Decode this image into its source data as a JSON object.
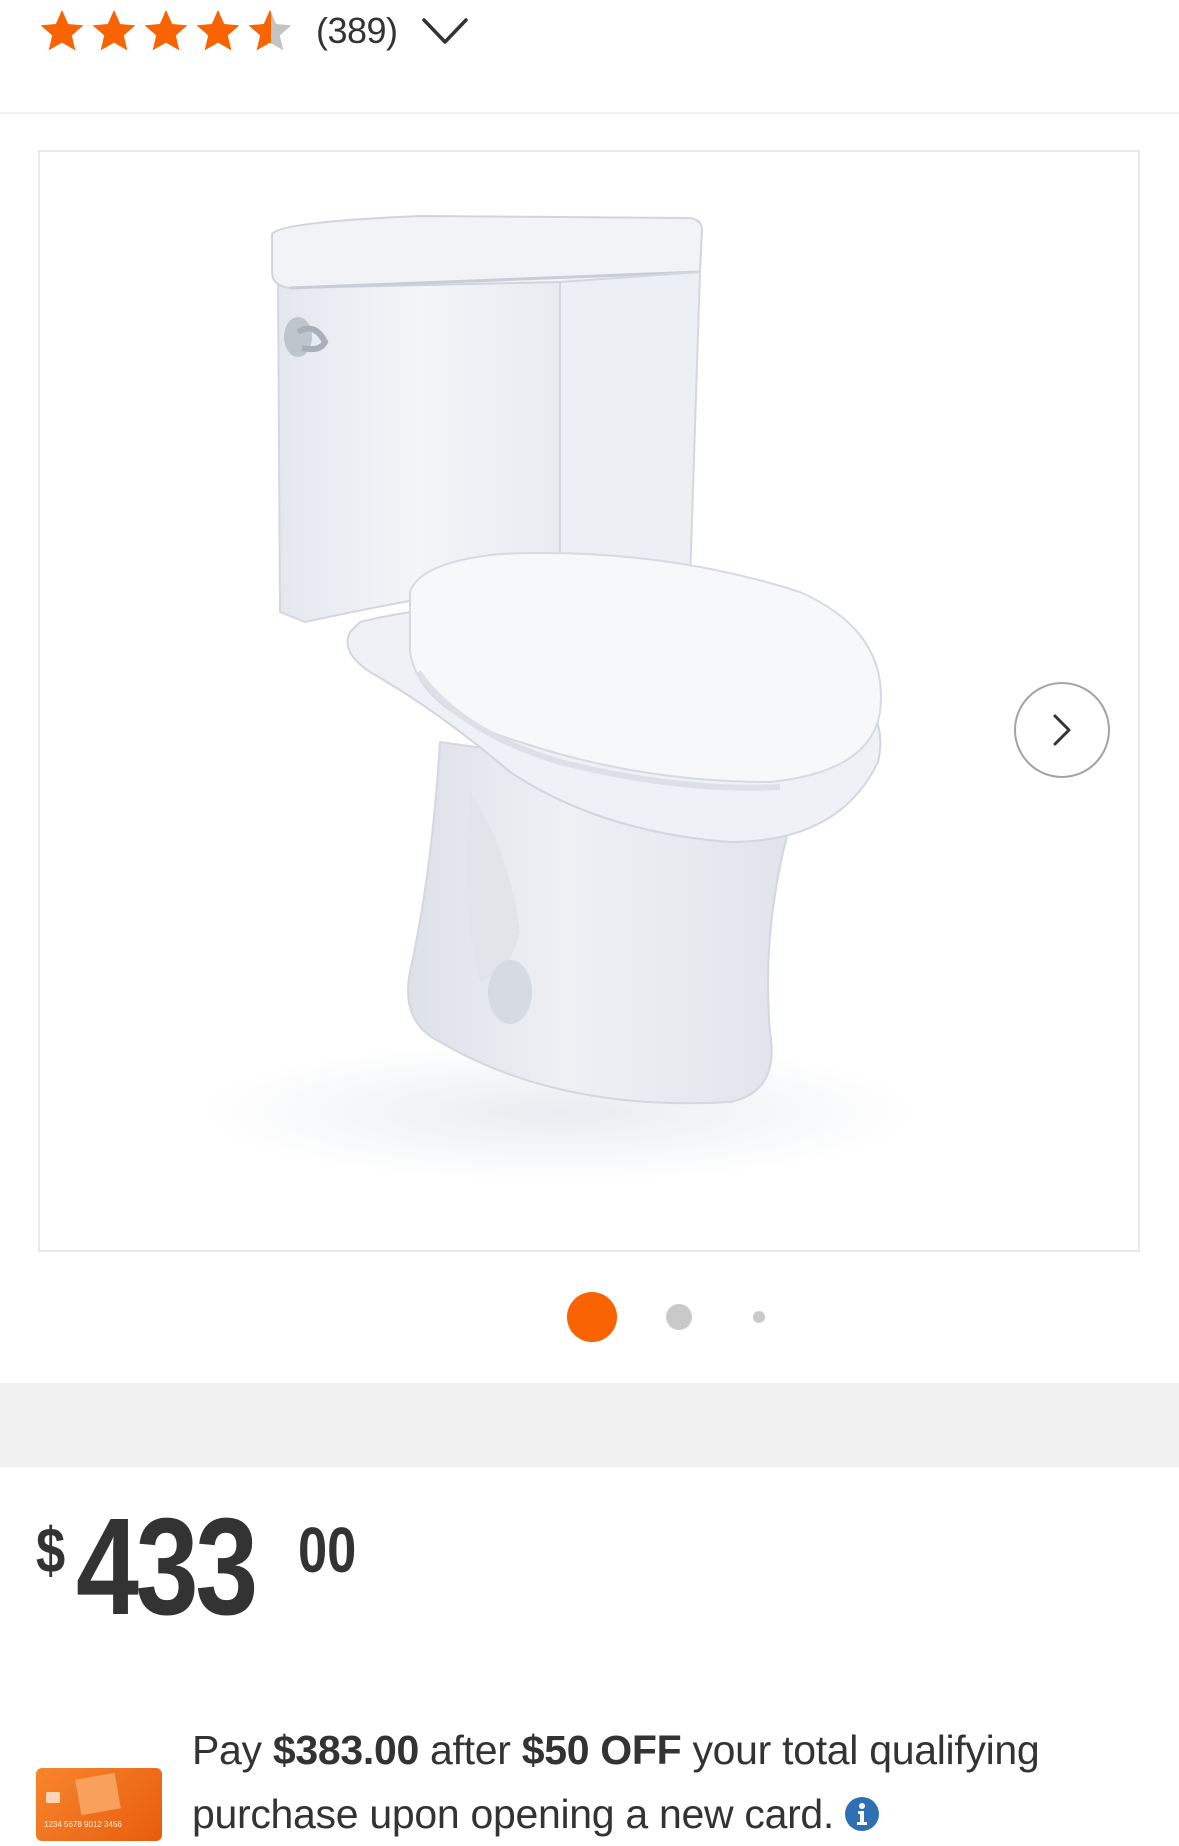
{
  "rating": {
    "value": 4.5,
    "max": 5,
    "review_count": "(389)",
    "star_color": "#f96302",
    "empty_star_color": "#c4c4c4"
  },
  "gallery": {
    "image_alt": "Two-piece white toilet",
    "next_icon": "chevron-right-icon",
    "dot_count": 3,
    "active_dot": 1,
    "active_color": "#f96302"
  },
  "price": {
    "currency": "$",
    "dollars": "433",
    "cents": "00"
  },
  "promo": {
    "text_1": "Pay ",
    "amount": "$383.00",
    "text_2": " after ",
    "discount": "$50 OFF",
    "text_3": " your total qualifying purchase upon opening a new card.",
    "card_number": "1234 5678 9012 3456",
    "info_icon": "info-icon"
  }
}
